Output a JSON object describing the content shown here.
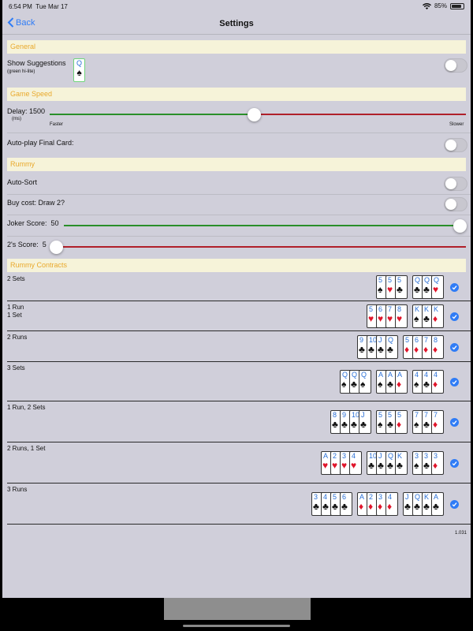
{
  "status": {
    "time": "6:54 PM",
    "date": "Tue Mar 17",
    "battery": "85%",
    "battery_level": 0.85
  },
  "nav": {
    "back": "Back",
    "title": "Settings"
  },
  "general": {
    "header": "General",
    "show_suggestions": "Show Suggestions",
    "show_suggestions_sub": "(green hi-lite)",
    "suggestion_card": {
      "rank": "Q",
      "suit": "♠"
    },
    "show_suggestions_on": false
  },
  "speed": {
    "header": "Game Speed",
    "delay_label": "Delay:",
    "delay_value": "1500",
    "delay_unit": "(ms)",
    "faster": "Faster",
    "slower": "Slower",
    "delay_fraction": 0.49,
    "autoplay": "Auto-play Final Card:",
    "autoplay_on": false
  },
  "rummy": {
    "header": "Rummy",
    "autosort": "Auto-Sort",
    "autosort_on": false,
    "buycost": "Buy cost: Draw 2?",
    "buycost_on": false,
    "joker_label": "Joker Score:",
    "joker_value": "50",
    "joker_fraction": 1.0,
    "twos_label": "2's Score:",
    "twos_value": "5",
    "twos_fraction": 0.0
  },
  "contracts": {
    "header": "Rummy Contracts",
    "rows": [
      {
        "line1": "2 Sets",
        "line2": "",
        "groups": [
          [
            [
              "5",
              "♠"
            ],
            [
              "5",
              "♥"
            ],
            [
              "5",
              "♣"
            ]
          ],
          [
            [
              "Q",
              "♣"
            ],
            [
              "Q",
              "♣"
            ],
            [
              "Q",
              "♥"
            ]
          ]
        ]
      },
      {
        "line1": "1 Run",
        "line2": "1 Set",
        "groups": [
          [
            [
              "5",
              "♥"
            ],
            [
              "6",
              "♥"
            ],
            [
              "7",
              "♥"
            ],
            [
              "8",
              "♥"
            ]
          ],
          [
            [
              "K",
              "♠"
            ],
            [
              "K",
              "♣"
            ],
            [
              "K",
              "♦"
            ]
          ]
        ]
      },
      {
        "line1": "2 Runs",
        "line2": "",
        "groups": [
          [
            [
              "9",
              "♣"
            ],
            [
              "10",
              "♣"
            ],
            [
              "J",
              "♣"
            ],
            [
              "Q",
              "♣"
            ]
          ],
          [
            [
              "5",
              "♦"
            ],
            [
              "6",
              "♦"
            ],
            [
              "7",
              "♦"
            ],
            [
              "8",
              "♦"
            ]
          ]
        ]
      },
      {
        "line1": "3 Sets",
        "line2": "",
        "groups": [
          [
            [
              "Q",
              "♠"
            ],
            [
              "Q",
              "♣"
            ],
            [
              "Q",
              "♠"
            ]
          ],
          [
            [
              "A",
              "♠"
            ],
            [
              "A",
              "♣"
            ],
            [
              "A",
              "♦"
            ]
          ],
          [
            [
              "4",
              "♠"
            ],
            [
              "4",
              "♣"
            ],
            [
              "4",
              "♦"
            ]
          ]
        ]
      },
      {
        "line1": "1 Run, 2 Sets",
        "line2": "",
        "groups": [
          [
            [
              "8",
              "♣"
            ],
            [
              "9",
              "♣"
            ],
            [
              "10",
              "♣"
            ],
            [
              "J",
              "♣"
            ]
          ],
          [
            [
              "5",
              "♠"
            ],
            [
              "5",
              "♣"
            ],
            [
              "5",
              "♦"
            ]
          ],
          [
            [
              "7",
              "♠"
            ],
            [
              "7",
              "♣"
            ],
            [
              "7",
              "♦"
            ]
          ]
        ]
      },
      {
        "line1": "2 Runs, 1 Set",
        "line2": "",
        "groups": [
          [
            [
              "A",
              "♥"
            ],
            [
              "2",
              "♥"
            ],
            [
              "3",
              "♥"
            ],
            [
              "4",
              "♥"
            ]
          ],
          [
            [
              "10",
              "♣"
            ],
            [
              "J",
              "♣"
            ],
            [
              "Q",
              "♣"
            ],
            [
              "K",
              "♣"
            ]
          ],
          [
            [
              "3",
              "♠"
            ],
            [
              "3",
              "♣"
            ],
            [
              "3",
              "♦"
            ]
          ]
        ]
      },
      {
        "line1": "3 Runs",
        "line2": "",
        "groups": [
          [
            [
              "3",
              "♣"
            ],
            [
              "4",
              "♣"
            ],
            [
              "5",
              "♣"
            ],
            [
              "6",
              "♣"
            ]
          ],
          [
            [
              "A",
              "♦"
            ],
            [
              "2",
              "♦"
            ],
            [
              "3",
              "♦"
            ],
            [
              "4",
              "♦"
            ]
          ],
          [
            [
              "J",
              "♣"
            ],
            [
              "Q",
              "♣"
            ],
            [
              "K",
              "♣"
            ],
            [
              "A",
              "♣"
            ]
          ]
        ]
      }
    ]
  },
  "version": "1.031",
  "colors": {
    "accent": "#2f7cf6",
    "section_text": "#e9a92c",
    "slider_min": "#2a8f2a",
    "slider_max": "#b0202a"
  }
}
